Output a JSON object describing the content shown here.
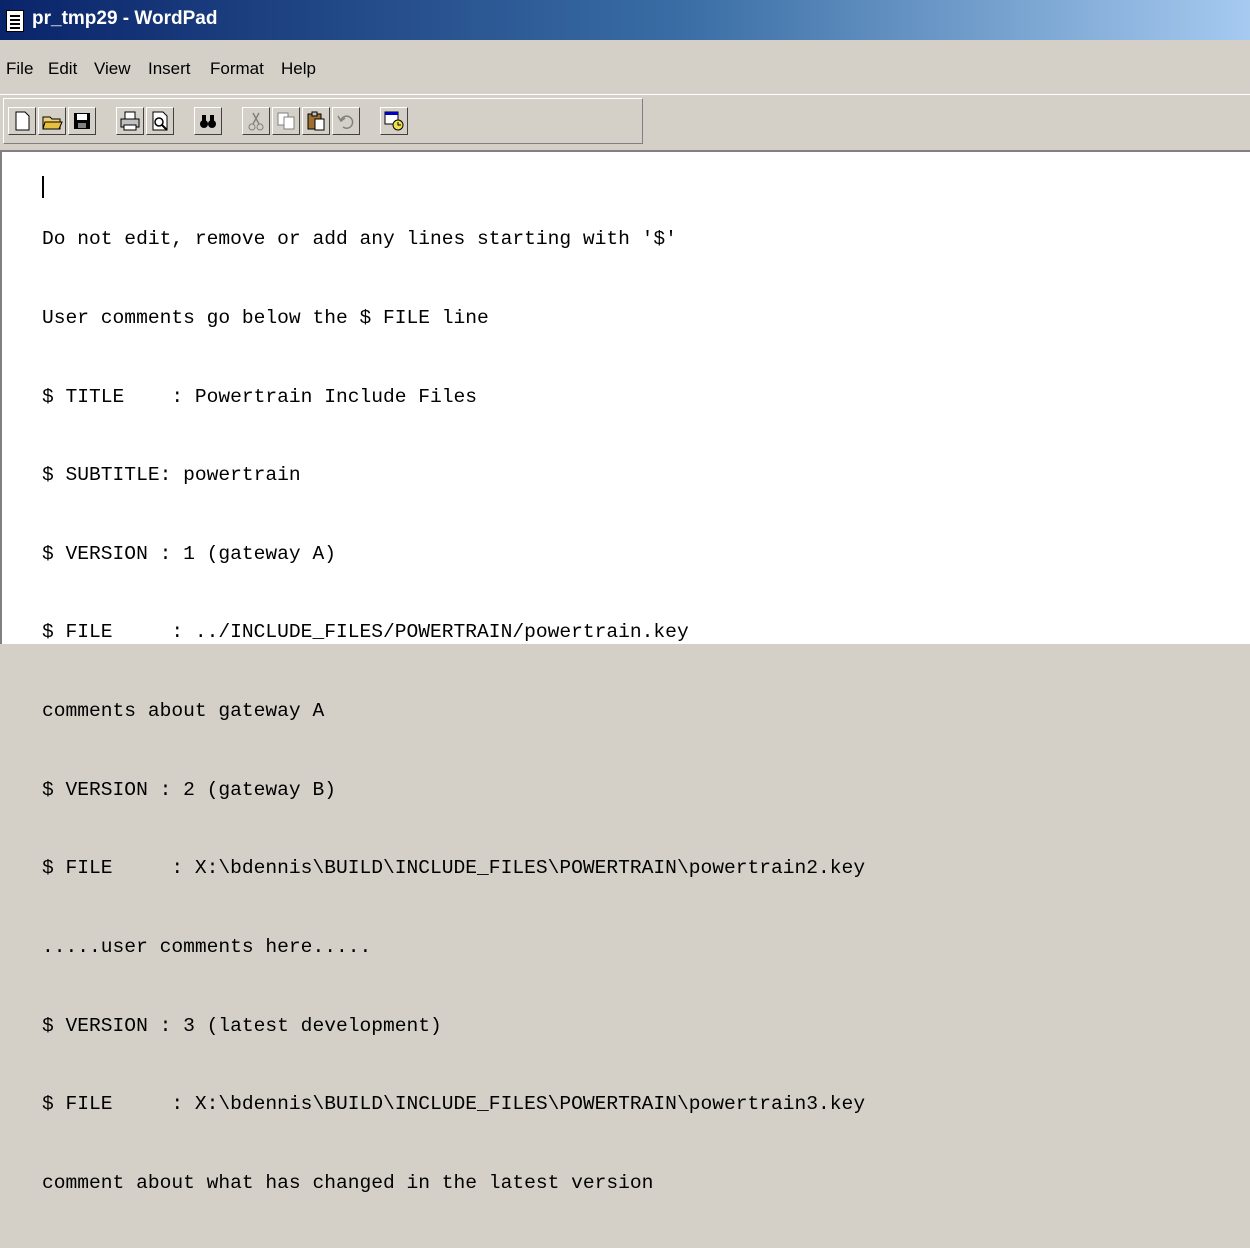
{
  "window": {
    "title": "pr_tmp29 - WordPad"
  },
  "menu": [
    "File",
    "Edit",
    "View",
    "Insert",
    "Format",
    "Help"
  ],
  "toolbar_icons": [
    "new-document-icon",
    "open-folder-icon",
    "save-icon",
    "print-icon",
    "print-preview-icon",
    "find-icon",
    "cut-icon",
    "copy-icon",
    "paste-icon",
    "undo-icon",
    "insert-date-time-icon"
  ],
  "document": {
    "lines": [
      "Do not edit, remove or add any lines starting with '$'",
      "User comments go below the $ FILE line",
      "$ TITLE    : Powertrain Include Files",
      "$ SUBTITLE: powertrain",
      "$ VERSION : 1 (gateway A)",
      "$ FILE     : ../INCLUDE_FILES/POWERTRAIN/powertrain.key",
      "comments about gateway A",
      "$ VERSION : 2 (gateway B)",
      "$ FILE     : X:\\bdennis\\BUILD\\INCLUDE_FILES\\POWERTRAIN\\powertrain2.key",
      ".....user comments here.....",
      "$ VERSION : 3 (latest development)",
      "$ FILE     : X:\\bdennis\\BUILD\\INCLUDE_FILES\\POWERTRAIN\\powertrain3.key",
      "comment about what has changed in the latest version"
    ]
  }
}
